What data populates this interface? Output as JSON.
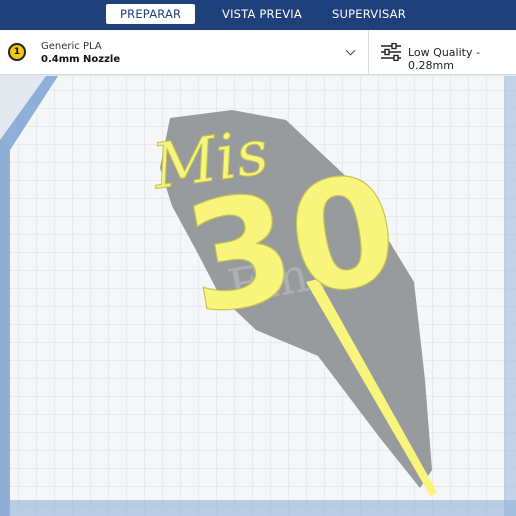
{
  "tabs": [
    {
      "label": "PREPARAR",
      "active": true
    },
    {
      "label": "VISTA PREVIA",
      "active": false
    },
    {
      "label": "SUPERVISAR",
      "active": false
    }
  ],
  "material": {
    "extruder_number": "1",
    "name": "Generic PLA",
    "nozzle": "0.4mm Nozzle"
  },
  "profile": {
    "label": "Low Quality - 0.28mm"
  },
  "model": {
    "text_script": "Mis",
    "text_number": "30"
  },
  "colors": {
    "topbar": "#1d3f7a",
    "model": "#f8f57c",
    "shadow": "#8f9296",
    "plate": "#f4f6f8",
    "grid": "#cfd6de"
  }
}
